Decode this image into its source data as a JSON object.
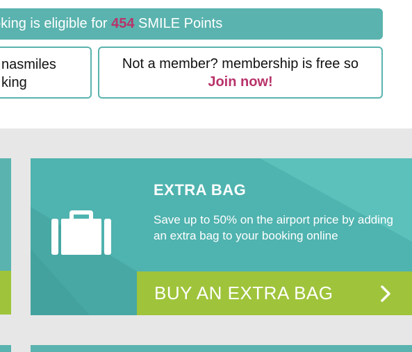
{
  "points_banner": {
    "prefix": "oking is eligible for",
    "points": "454",
    "suffix": "SMILE Points"
  },
  "member_card": {
    "line1": "nasmiles",
    "line2": "king"
  },
  "signup_card": {
    "line1": "Not a member? membership is free so",
    "join_label": "Join now!"
  },
  "extra_bag_promo": {
    "icon": "suitcase-icon",
    "title": "EXTRA BAG",
    "description": "Save up to 50% on the airport price by adding an extra bag to your booking online",
    "cta_label": "BUY AN EXTRA BAG",
    "cta_icon": "chevron-right-icon"
  },
  "colors": {
    "teal": "#5ab3ae",
    "green": "#9fc43b",
    "accent": "#b8336a",
    "band": "#e7e7e7"
  }
}
